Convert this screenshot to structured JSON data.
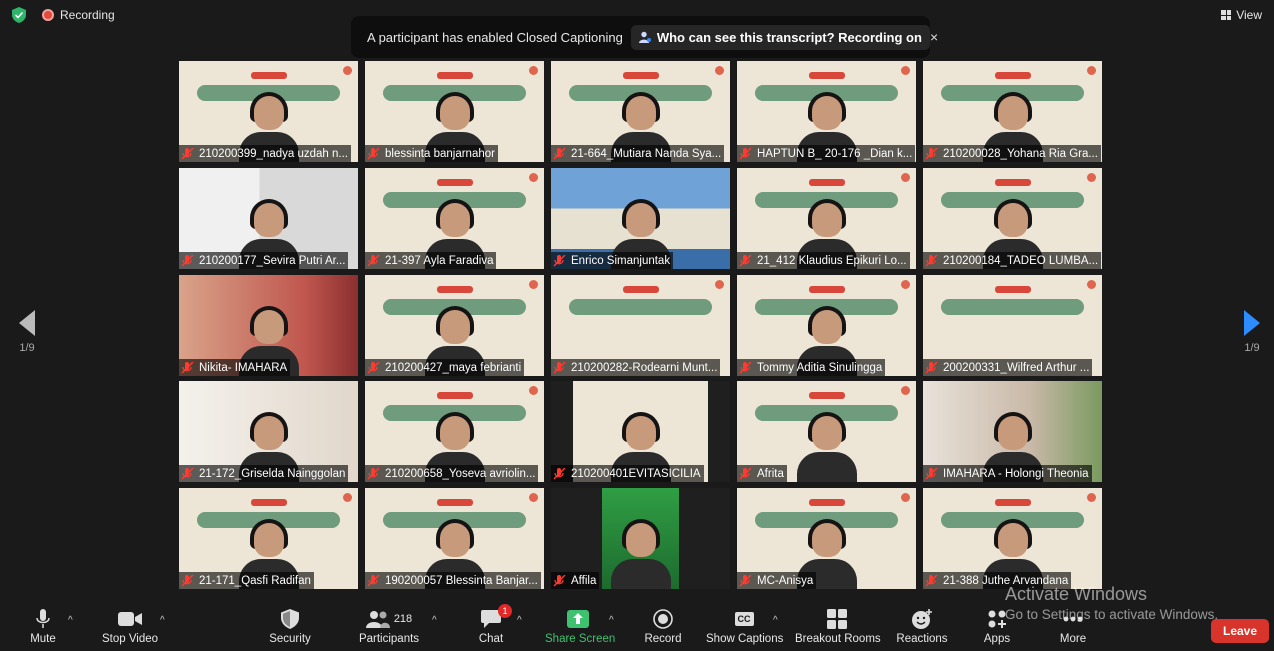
{
  "topbar": {
    "recording_label": "Recording",
    "view_label": "View"
  },
  "banner": {
    "message": "A participant has enabled Closed Captioning",
    "button_label": "Who can see this transcript? Recording on",
    "close_glyph": "×"
  },
  "pager": {
    "left": "1/9",
    "right": "1/9"
  },
  "participants": [
    {
      "name": "210200399_nadya uzdah n..."
    },
    {
      "name": "blessinta banjarnahor"
    },
    {
      "name": "21-664_Mutiara Nanda Sya..."
    },
    {
      "name": "HAPTUN B_ 20-176 _Dian k..."
    },
    {
      "name": "210200028_Yohana Ria Gra..."
    },
    {
      "name": "210200177_Sevira Putri Ar..."
    },
    {
      "name": "21-397 Ayla Faradiva"
    },
    {
      "name": "Enrico Simanjuntak"
    },
    {
      "name": "21_412 Klaudius Epikuri Lo..."
    },
    {
      "name": "210200184_TADEO LUMBA..."
    },
    {
      "name": "Nikita- IMAHARA"
    },
    {
      "name": "210200427_maya febrianti"
    },
    {
      "name": "210200282-Rodearni Munt..."
    },
    {
      "name": "Tommy Aditia Sinulingga"
    },
    {
      "name": "200200331_Wilfred Arthur ..."
    },
    {
      "name": "21-172_Griselda Nainggolan"
    },
    {
      "name": "210200658_Yoseva avriolin..."
    },
    {
      "name": "210200401EVITASICILIA"
    },
    {
      "name": "Afrita"
    },
    {
      "name": "IMAHARA - Holongi Theonia"
    },
    {
      "name": "21-171_Qasfi Radifan"
    },
    {
      "name": "190200057 Blessinta Banjar..."
    },
    {
      "name": "Affila"
    },
    {
      "name": "MC-Anisya"
    },
    {
      "name": "21-388 Juthe Arvandana"
    }
  ],
  "toolbar": {
    "mute": "Mute",
    "stop_video": "Stop Video",
    "security": "Security",
    "participants": "Participants",
    "participants_count": "218",
    "chat": "Chat",
    "chat_badge": "1",
    "share_screen": "Share Screen",
    "record": "Record",
    "show_captions": "Show Captions",
    "cc_glyph": "CC",
    "breakout_rooms": "Breakout Rooms",
    "reactions": "Reactions",
    "apps": "Apps",
    "more": "More",
    "leave": "Leave"
  },
  "watermark": {
    "line1": "Activate Windows",
    "line2": "Go to Settings to activate Windows."
  },
  "colors": {
    "accent": "#2d8cff",
    "leave": "#d9342b",
    "share": "#3ec26f",
    "active_speaker": "#8cc63f"
  }
}
